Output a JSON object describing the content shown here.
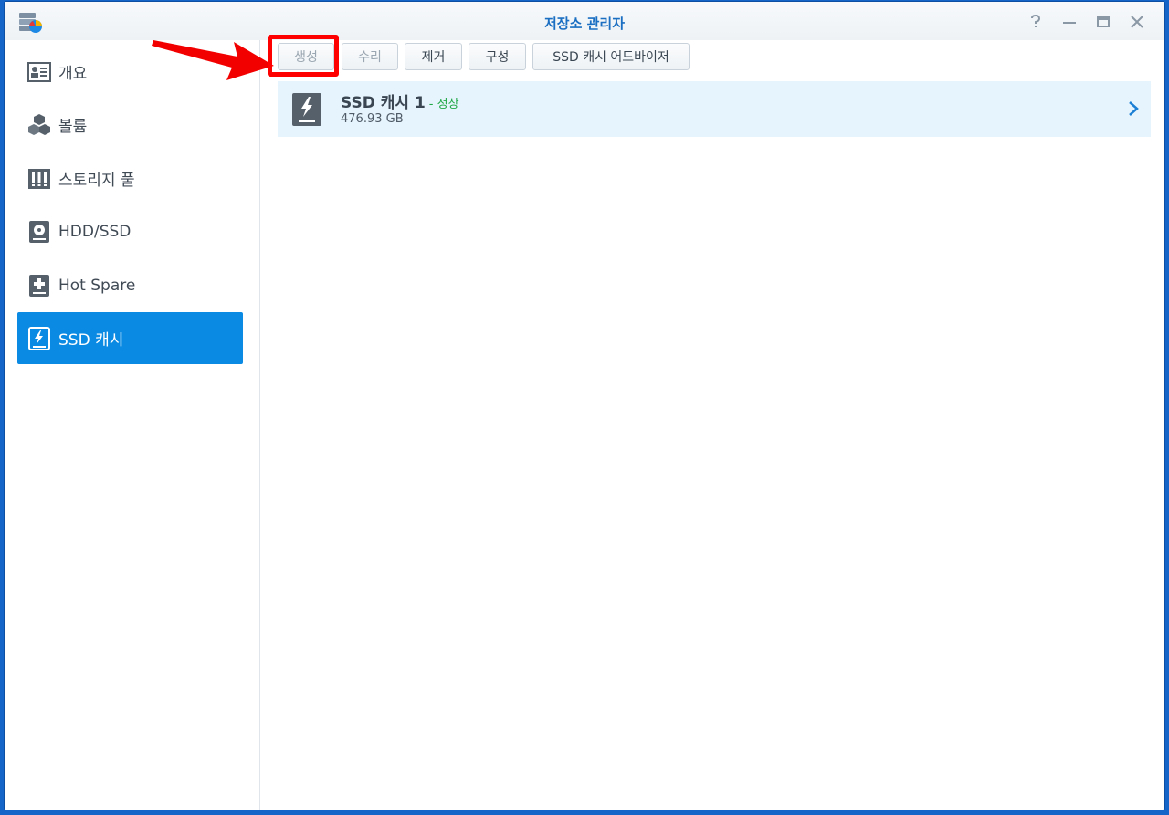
{
  "window": {
    "title": "저장소 관리자"
  },
  "sidebar": {
    "items": [
      {
        "label": "개요",
        "icon": "overview-icon"
      },
      {
        "label": "볼륨",
        "icon": "volume-icon"
      },
      {
        "label": "스토리지 풀",
        "icon": "storage-pool-icon"
      },
      {
        "label": "HDD/SSD",
        "icon": "hdd-icon"
      },
      {
        "label": "Hot Spare",
        "icon": "hot-spare-icon"
      },
      {
        "label": "SSD 캐시",
        "icon": "ssd-cache-icon",
        "active": true
      }
    ]
  },
  "toolbar": {
    "create_label": "생성",
    "repair_label": "수리",
    "remove_label": "제거",
    "configure_label": "구성",
    "advisor_label": "SSD 캐시 어드바이저"
  },
  "cache": {
    "name": "SSD 캐시 1",
    "status": "- 정상",
    "size": "476.93 GB"
  },
  "colors": {
    "accent": "#0a8ae3",
    "status_ok": "#1fa845",
    "highlight": "#ff0000"
  }
}
